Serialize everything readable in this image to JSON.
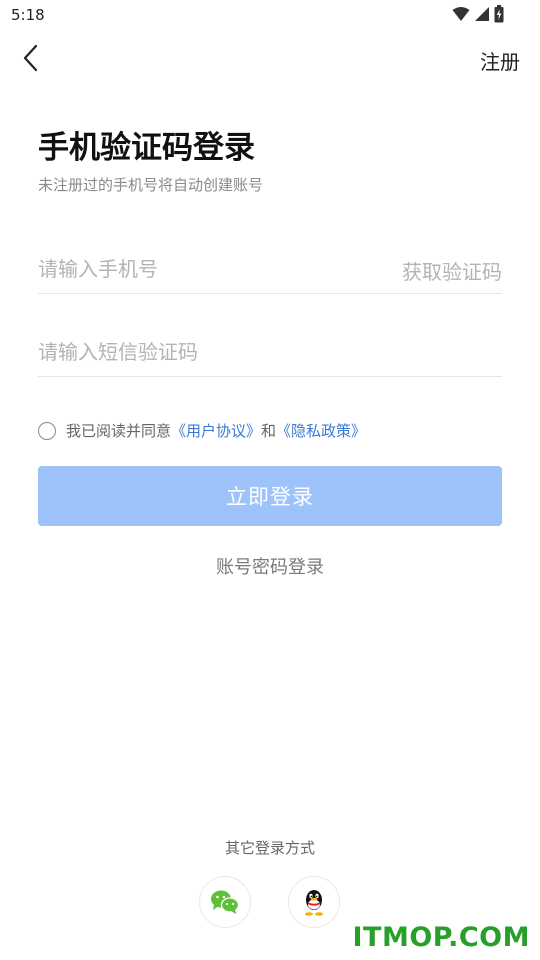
{
  "status_bar": {
    "time": "5:18"
  },
  "header": {
    "register_label": "注册"
  },
  "main": {
    "title": "手机验证码登录",
    "subtitle": "未注册过的手机号将自动创建账号",
    "phone_placeholder": "请输入手机号",
    "get_code_label": "获取验证码",
    "code_placeholder": "请输入短信验证码",
    "agreement": {
      "prefix": "我已阅读并同意",
      "user_agreement": "《用户协议》",
      "and": "和",
      "privacy_policy": "《隐私政策》"
    },
    "login_label": "立即登录",
    "password_login_label": "账号密码登录"
  },
  "footer": {
    "other_methods_label": "其它登录方式",
    "methods": [
      {
        "icon": "wechat-icon",
        "color": "#5ebf3a"
      },
      {
        "icon": "qq-icon",
        "color": "#111111"
      }
    ]
  },
  "watermark": "ITMOP.COM",
  "colors": {
    "accent": "#3a78d8",
    "login_button_disabled": "#9dc3fa",
    "placeholder": "#b3b3b3",
    "watermark": "#27a02a"
  }
}
